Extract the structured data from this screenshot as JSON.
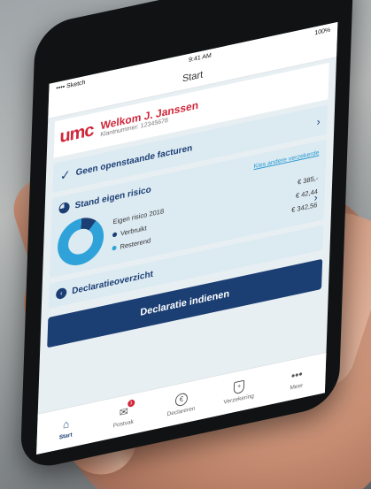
{
  "status": {
    "carrier": "•••• Sketch",
    "time": "9:41 AM",
    "battery": "100%"
  },
  "nav": {
    "title": "Start"
  },
  "welcome": {
    "logo": "umc",
    "title": "Welkom J. Janssen",
    "subtitle": "Klantnummer: 12345678"
  },
  "invoices": {
    "title": "Geen openstaande facturen"
  },
  "risk": {
    "title": "Stand eigen risico",
    "link": "Kies andere verzekerde",
    "year_label": "Eigen risico 2018",
    "year_value": "€ 385,-",
    "used_label": "Verbruikt",
    "used_value": "€ 42,44",
    "remaining_label": "Resterend",
    "remaining_value": "€ 342,56",
    "used_fraction": 0.11,
    "colors": {
      "used": "#1b3e73",
      "remaining": "#2fa3d9"
    }
  },
  "claims": {
    "title": "Declaratieoverzicht"
  },
  "cta": {
    "label": "Declaratie indienen"
  },
  "tabs": [
    {
      "label": "Start",
      "icon": "home-icon",
      "active": true
    },
    {
      "label": "Postvak",
      "icon": "mail-icon",
      "badge": "1"
    },
    {
      "label": "Declareren",
      "icon": "euro-icon"
    },
    {
      "label": "Verzekering",
      "icon": "shield-icon"
    },
    {
      "label": "Meer",
      "icon": "more-icon"
    }
  ]
}
